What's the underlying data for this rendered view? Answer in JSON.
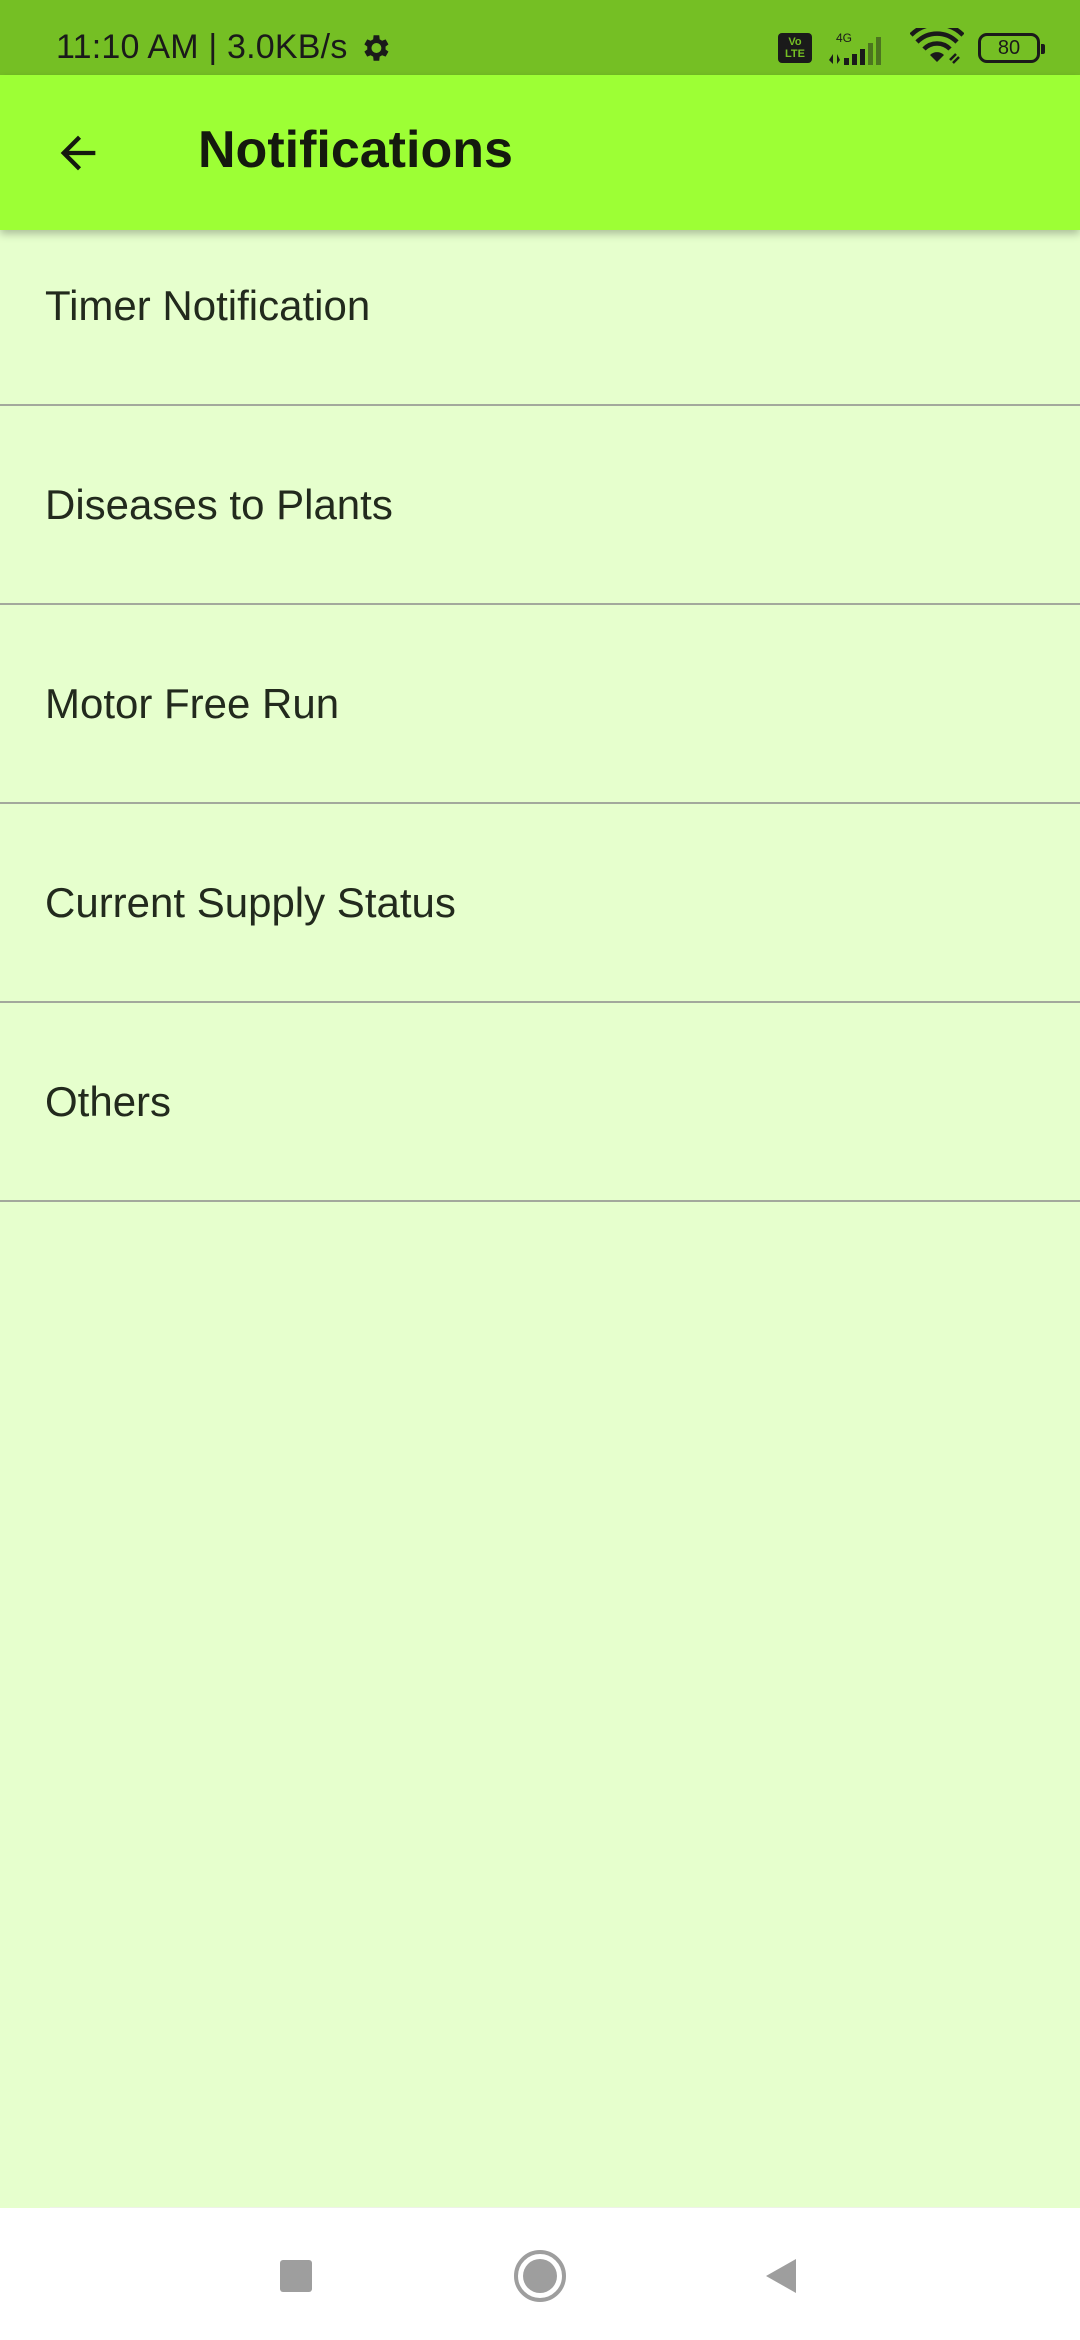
{
  "status_bar": {
    "time_speed": "11:10 AM | 3.0KB/s",
    "volte_label": "Vo LTE",
    "network_label": "4G",
    "battery_level": "80"
  },
  "app_bar": {
    "title": "Notifications",
    "back_icon": "arrow-left-icon"
  },
  "notification_categories": [
    {
      "label": "Timer Notification"
    },
    {
      "label": "Diseases to Plants"
    },
    {
      "label": "Motor Free Run"
    },
    {
      "label": "Current Supply Status"
    },
    {
      "label": "Others"
    }
  ],
  "nav_bar": {
    "recents_icon": "square-icon",
    "home_icon": "circle-icon",
    "back_icon": "triangle-back-icon"
  },
  "colors": {
    "status_bar": "#75bf24",
    "app_bar": "#9dff35",
    "background": "#e6ffcd",
    "divider": "#a3a99c"
  }
}
